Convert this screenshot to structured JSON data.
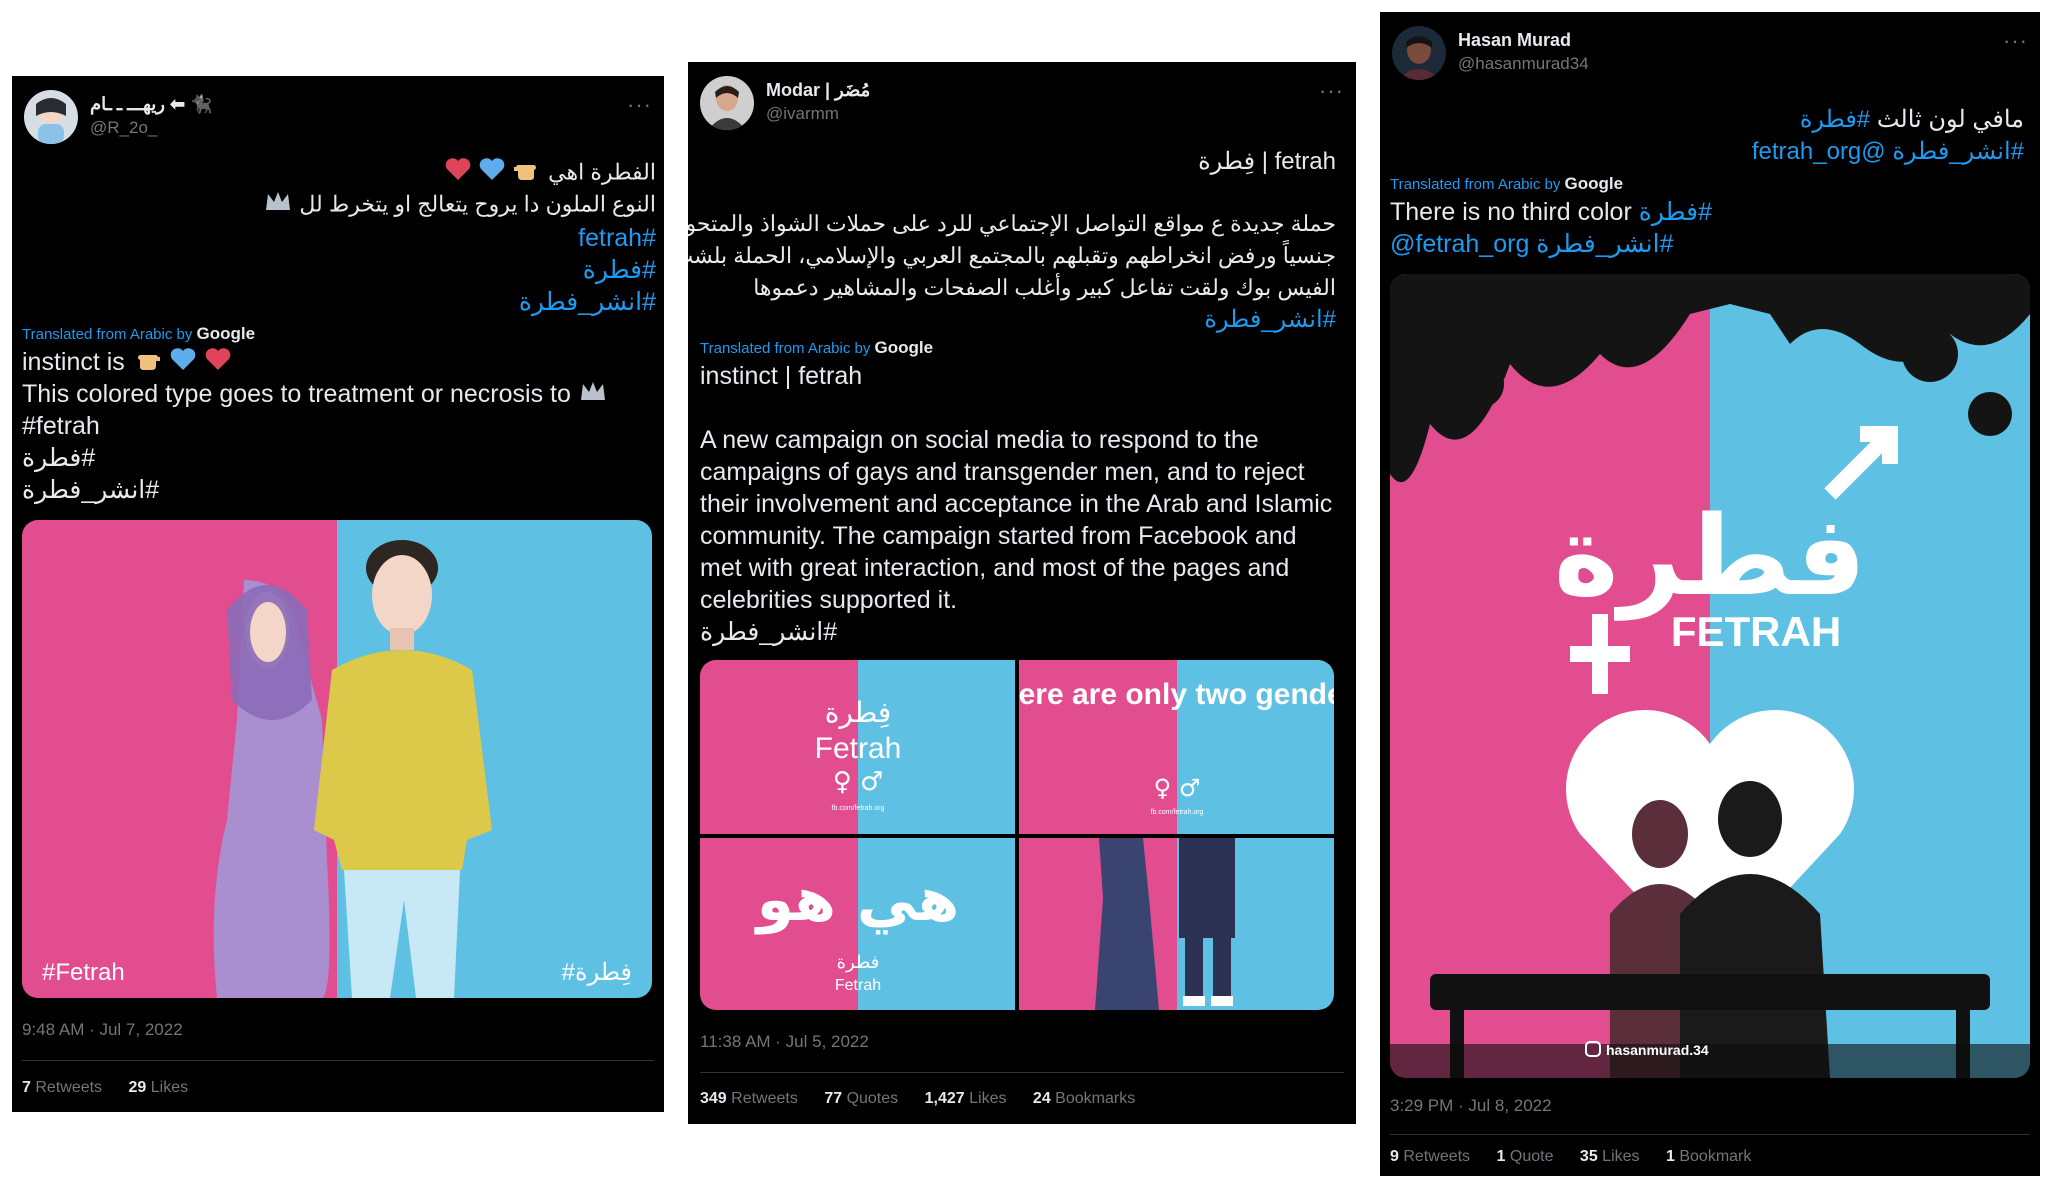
{
  "tweet1": {
    "name": "ريهـــ ـ ـام ⬅ 🐈‍⬛",
    "handle": "@R_2o_",
    "more": "···",
    "arabic_line1": "الفطرة اهي",
    "arabic_line2": "النوع الملون دا يروح يتعالج او يتخرط لل",
    "tag_fetrah": "#fetrah",
    "tag_fitra": "#فطرة",
    "tag_spread": "#انشر_فطرة",
    "translated_by": "Translated from Arabic by",
    "google": "Google",
    "en_line1": "instinct is",
    "en_line2": "This colored type goes to treatment or necrosis to",
    "en_tag1": "#fetrah",
    "en_tag2": "فطرة#",
    "en_tag3": "انشر_فطرة#",
    "image_left_text": "#Fetrah",
    "image_right_text": "#فِطرة",
    "timestamp": "9:48 AM · Jul 7, 2022",
    "retweets_count": "7",
    "retweets_label": "Retweets",
    "likes_count": "29",
    "likes_label": "Likes"
  },
  "tweet2": {
    "name": "Modar | مُضَر",
    "handle": "@ivarmm",
    "more": "···",
    "arabic_title": "fetrah | فِطرة",
    "arabic_p1": "حملة جديدة ع مواقع التواصل الإجتماعي للرد على حملات الشواذ والمتحولين",
    "arabic_p2": "جنسياً ورفض انخراطهم وتقبلهم بالمجتمع العربي والإسلامي، الحملة بلشت من",
    "arabic_p3": "الفيس بوك ولقت تفاعل كبير وأغلب الصفحات والمشاهير دعموها",
    "arabic_tag": "#انشر_فطرة",
    "translated_by": "Translated from Arabic by",
    "google": "Google",
    "en_title": "instinct | fetrah",
    "en_body": "A new campaign on social media to respond to the campaigns of gays and transgender men, and to reject their involvement and acceptance in the Arab and Islamic community. The campaign started from Facebook and met with great interaction, and most of the pages and celebrities supported it.",
    "en_tag": "انشر_فطرة#",
    "panel1_ar": "فِطرة",
    "panel1_en": "Fetrah",
    "panel1_symbols": "♀ ♂",
    "panel1_small": "fb.com/fetrah.org",
    "panel2_text": "There are only two genders",
    "panel2_symbols": "♀ ♂",
    "panel2_small": "fb.com/fetrah.org",
    "panel3_logo": "هي هو",
    "panel3_ar": "فطرة",
    "panel3_en": "Fetrah",
    "timestamp": "11:38 AM · Jul 5, 2022",
    "retweets_count": "349",
    "retweets_label": "Retweets",
    "quotes_count": "77",
    "quotes_label": "Quotes",
    "likes_count": "1,427",
    "likes_label": "Likes",
    "bookmarks_count": "24",
    "bookmarks_label": "Bookmarks"
  },
  "tweet3": {
    "name": "Hasan Murad",
    "handle": "@hasanmurad34",
    "more": "···",
    "arabic_line1_text": "مافي لون ثالث",
    "arabic_line1_tag": "#فطرة",
    "arabic_line2_tag": "#انشر_فطرة",
    "arabic_line2_mention": "@fetrah_org",
    "translated_by": "Translated from Arabic by",
    "google": "Google",
    "en_line1_text": "There is no third color",
    "en_line1_tag": "فطرة#",
    "en_line2_mention": "@fetrah_org",
    "en_line2_tag": "انشر_فطرة#",
    "poster_ar": "فطرة",
    "poster_en": "FETRAH",
    "poster_credit": "hasanmurad.34",
    "timestamp": "3:29 PM · Jul 8, 2022",
    "retweets_count": "9",
    "retweets_label": "Retweets",
    "quotes_count": "1",
    "quotes_label": "Quote",
    "likes_count": "35",
    "likes_label": "Likes",
    "bookmarks_count": "1",
    "bookmarks_label": "Bookmark"
  },
  "colors": {
    "pink": "#e24d8f",
    "blue": "#5ec1e4",
    "link": "#1d9bf0",
    "muted": "#71767b"
  }
}
